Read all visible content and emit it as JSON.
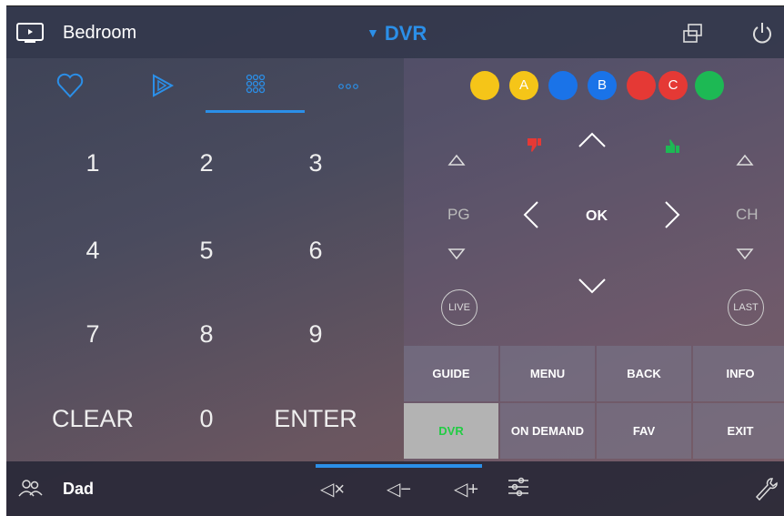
{
  "header": {
    "room": "Bedroom",
    "source": "DVR",
    "icons": [
      "tv-icon",
      "window-icon",
      "power-icon"
    ]
  },
  "tabs": [
    "favorites",
    "play",
    "keypad",
    "more"
  ],
  "keypad": {
    "keys": [
      "1",
      "2",
      "3",
      "4",
      "5",
      "6",
      "7",
      "8",
      "9",
      "CLEAR",
      "0",
      "ENTER"
    ]
  },
  "color_buttons": [
    {
      "color": "#f5c518",
      "label": ""
    },
    {
      "color": "#f5c518",
      "label": "A"
    },
    {
      "color": "#1a73e8",
      "label": ""
    },
    {
      "color": "#1a73e8",
      "label": "B"
    },
    {
      "color": "#e53935",
      "label": ""
    },
    {
      "color": "#e53935",
      "label": "C"
    },
    {
      "color": "#1db954",
      "label": ""
    }
  ],
  "dpad": {
    "ok": "OK",
    "pg_label": "PG",
    "ch_label": "CH",
    "live": "LIVE",
    "last": "LAST"
  },
  "grid_buttons": [
    {
      "label": "GUIDE"
    },
    {
      "label": "MENU"
    },
    {
      "label": "BACK"
    },
    {
      "label": "INFO"
    },
    {
      "label": "DVR"
    },
    {
      "label": "ON DEMAND"
    },
    {
      "label": "FAV"
    },
    {
      "label": "EXIT"
    }
  ],
  "footer": {
    "user": "Dad",
    "mute": "◁×",
    "vol_down": "◁−",
    "vol_up": "◁+"
  },
  "colors": {
    "accent": "#2b8fe8",
    "active_text": "#22cc44"
  }
}
